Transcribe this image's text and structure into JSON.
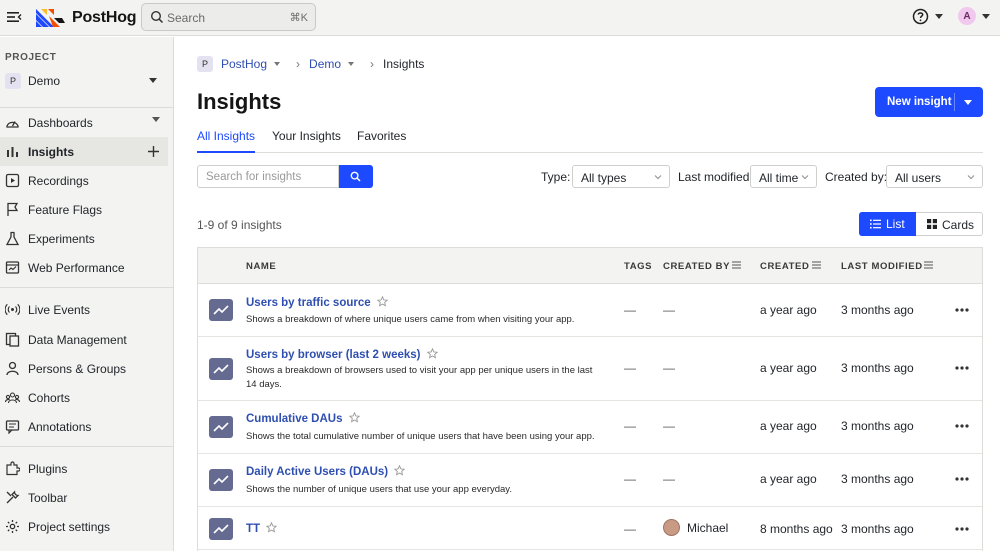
{
  "topbar": {
    "brand": "PostHog",
    "search_placeholder": "Search",
    "search_shortcut": "⌘K",
    "avatar_initial": "A"
  },
  "sidebar": {
    "project_label": "PROJECT",
    "project_badge": "P",
    "project_name": "Demo",
    "items": [
      {
        "label": "Dashboards",
        "icon": "dashboard-icon"
      },
      {
        "label": "Insights",
        "icon": "insights-bar-chart-icon",
        "active": true
      },
      {
        "label": "Recordings",
        "icon": "recording-play-icon"
      },
      {
        "label": "Feature Flags",
        "icon": "flag-icon"
      },
      {
        "label": "Experiments",
        "icon": "flask-icon"
      },
      {
        "label": "Web Performance",
        "icon": "web-performance-icon"
      },
      {
        "label": "Live Events",
        "icon": "live-broadcast-icon"
      },
      {
        "label": "Data Management",
        "icon": "data-management-icon"
      },
      {
        "label": "Persons & Groups",
        "icon": "person-icon"
      },
      {
        "label": "Cohorts",
        "icon": "cohort-group-icon"
      },
      {
        "label": "Annotations",
        "icon": "annotation-comment-icon"
      },
      {
        "label": "Plugins",
        "icon": "plugin-icon"
      },
      {
        "label": "Toolbar",
        "icon": "toolbar-tools-icon"
      },
      {
        "label": "Project settings",
        "icon": "settings-gear-icon"
      }
    ]
  },
  "breadcrumb": {
    "badge": "P",
    "org": "PostHog",
    "project": "Demo",
    "current": "Insights"
  },
  "page": {
    "title": "Insights",
    "new_button": "New insight"
  },
  "tabs": [
    "All Insights",
    "Your Insights",
    "Favorites"
  ],
  "filters": {
    "search_placeholder": "Search for insights",
    "type_label": "Type:",
    "type_value": "All types",
    "modified_label": "Last modified:",
    "modified_value": "All time",
    "created_by_label": "Created by:",
    "created_by_value": "All users"
  },
  "results_count": "1-9 of 9 insights",
  "view_toggle": {
    "list": "List",
    "cards": "Cards"
  },
  "table": {
    "columns": [
      "NAME",
      "TAGS",
      "CREATED BY",
      "CREATED",
      "LAST MODIFIED"
    ],
    "rows": [
      {
        "name": "Users by traffic source",
        "desc": "Shows a breakdown of where unique users came from when visiting your app.",
        "tags": "—",
        "created_by": "—",
        "created": "a year ago",
        "modified": "3 months ago"
      },
      {
        "name": "Users by browser (last 2 weeks)",
        "desc": "Shows a breakdown of browsers used to visit your app per unique users in the last 14 days.",
        "tags": "—",
        "created_by": "—",
        "created": "a year ago",
        "modified": "3 months ago"
      },
      {
        "name": "Cumulative DAUs",
        "desc": "Shows the total cumulative number of unique users that have been using your app.",
        "tags": "—",
        "created_by": "—",
        "created": "a year ago",
        "modified": "3 months ago"
      },
      {
        "name": "Daily Active Users (DAUs)",
        "desc": "Shows the number of unique users that use your app everyday.",
        "tags": "—",
        "created_by": "—",
        "created": "a year ago",
        "modified": "3 months ago"
      },
      {
        "name": "TT",
        "desc": "",
        "tags": "—",
        "created_by": "Michael",
        "created": "8 months ago",
        "modified": "3 months ago"
      }
    ]
  },
  "colors": {
    "accent": "#1d4aff",
    "link": "#2f4fb0",
    "sidebar_bg": "#f3f3f1",
    "insight_icon_bg": "#646a90"
  }
}
